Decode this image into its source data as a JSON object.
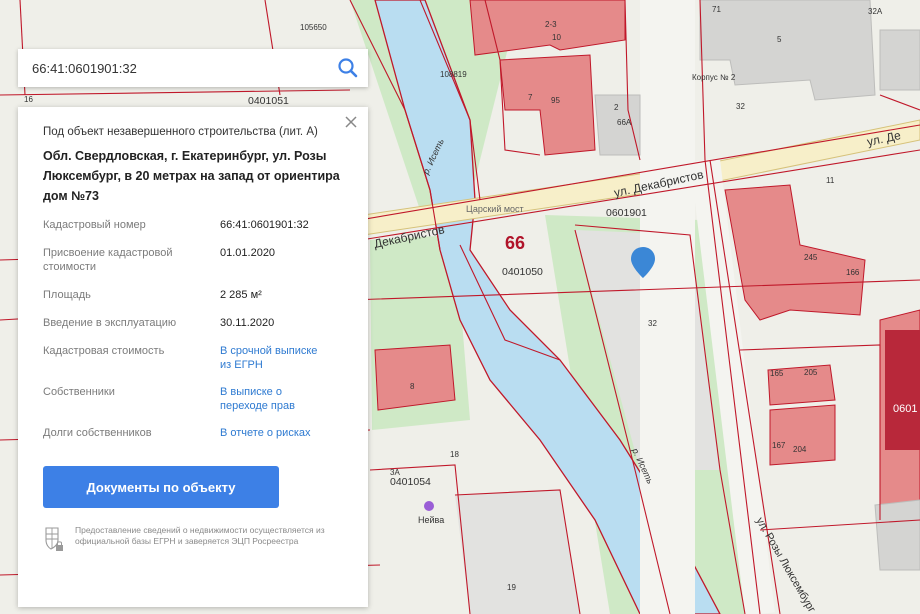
{
  "search": {
    "value": "66:41:0601901:32"
  },
  "object": {
    "type": "Под объект незавершенного строительства (лит. А)",
    "address": "Обл. Свердловская, г. Екатеринбург, ул. Розы Люксембург, в 20 метрах на запад от ориентира дом №73"
  },
  "properties": [
    {
      "label": "Кадастровый номер",
      "value": "66:41:0601901:32",
      "link": false
    },
    {
      "label": "Присвоение кадастровой стоимости",
      "value": "01.01.2020",
      "link": false
    },
    {
      "label": "Площадь",
      "value": "2 285 м²",
      "link": false
    },
    {
      "label": "Введение в эксплуатацию",
      "value": "30.11.2020",
      "link": false
    },
    {
      "label": "Кадастровая стоимость",
      "value": "В срочной выписке из ЕГРН",
      "link": true
    },
    {
      "label": "Собственники",
      "value": "В выписке о переходе прав",
      "link": true
    },
    {
      "label": "Долги собственников",
      "value": "В отчете о рисках",
      "link": true
    }
  ],
  "documents_button": "Документы по объекту",
  "disclaimer": "Предоставление сведений о недвижимости осуществляется из официальной базы ЕГРН и заверяется ЭЦП Росреестра",
  "map": {
    "streets": {
      "dekabristov_1": "ул. Декабристов",
      "dekabristov_2": "Декабристов",
      "dekabristov_3": "ул. Де",
      "roza_lux": "ул. Розы Люксембург",
      "river_1": "р. Исеть",
      "river_2": "р. Исеть",
      "bridge": "Царский мост"
    },
    "district_number": "66",
    "quarters": [
      "0401051",
      "0401050",
      "0601901",
      "0401054",
      "108819",
      "105650",
      "0601"
    ],
    "building_numbers": [
      "2-3",
      "10",
      "71",
      "32А",
      "5",
      "Корпус № 2",
      "32",
      "7",
      "95",
      "2",
      "66А",
      "11",
      "245",
      "166",
      "32",
      "165",
      "205",
      "167",
      "204",
      "18",
      "3А",
      "19",
      "16",
      "8",
      "95",
      "8"
    ],
    "poi": [
      "Нейва"
    ],
    "colors": {
      "building_red": "#e58a8a",
      "river": "#b8dcf0",
      "border": "#c0182a",
      "green": "#c9e7c2",
      "marker": "#3b87d6"
    }
  }
}
